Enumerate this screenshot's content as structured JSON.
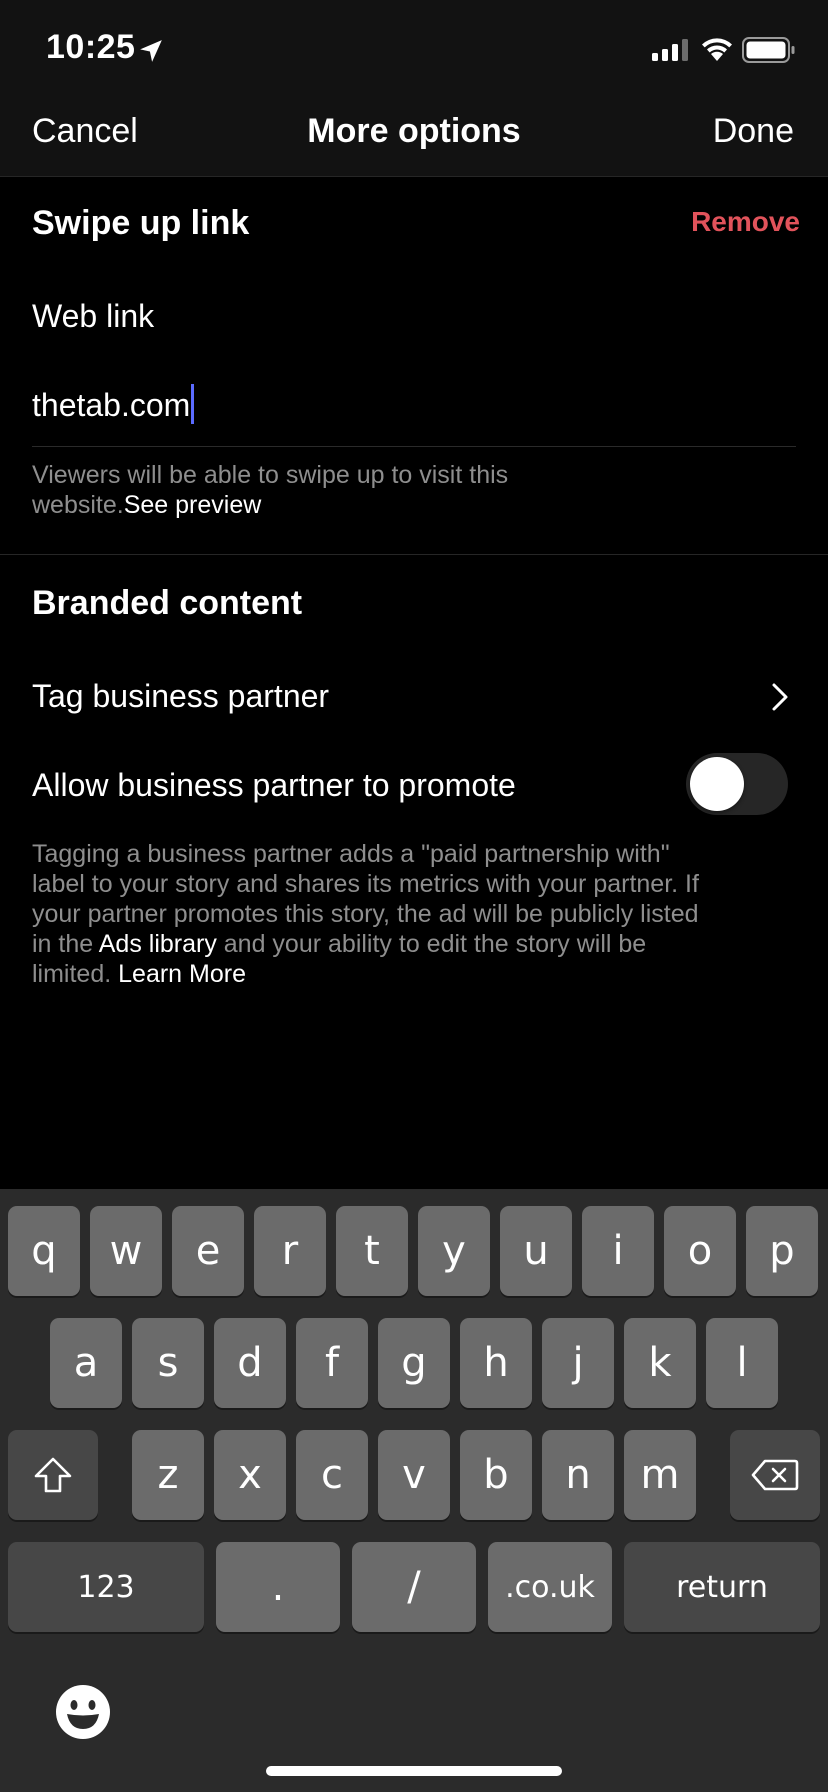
{
  "status_bar": {
    "time": "10:25",
    "location_icon": "location-arrow-icon",
    "signal_icon": "cellular-signal-icon",
    "wifi_icon": "wifi-icon",
    "battery_icon": "battery-icon"
  },
  "nav": {
    "cancel": "Cancel",
    "title": "More options",
    "done": "Done"
  },
  "swipe_up": {
    "title": "Swipe up link",
    "remove": "Remove",
    "field_label": "Web link",
    "field_value": "thetab.com",
    "helper_line1": "Viewers will be able to swipe up to visit this",
    "helper_line2": "website.",
    "helper_link": "See preview"
  },
  "branded": {
    "title": "Branded content",
    "tag_partner": "Tag business partner",
    "allow_promote": "Allow business partner to promote",
    "toggle_on": false,
    "info_line1": "Tagging a business partner adds a \"paid partnership with\"",
    "info_line2": "label to your story and shares its metrics with your partner. If",
    "info_line3": "your partner promotes this story, the ad will be publicly listed",
    "info_line4_pre": "in the ",
    "info_line4_link": "Ads library",
    "info_line4_post": " and your ability to edit the story will be",
    "info_line5_pre": "limited. ",
    "info_line5_link": "Learn More"
  },
  "keyboard": {
    "row1": [
      "q",
      "w",
      "e",
      "r",
      "t",
      "y",
      "u",
      "i",
      "o",
      "p"
    ],
    "row2": [
      "a",
      "s",
      "d",
      "f",
      "g",
      "h",
      "j",
      "k",
      "l"
    ],
    "row3": [
      "z",
      "x",
      "c",
      "v",
      "b",
      "n",
      "m"
    ],
    "numbers": "123",
    "dot": ".",
    "slash": "/",
    "domain": ".co.uk",
    "return": "return",
    "shift_icon": "shift-arrow-icon",
    "delete_icon": "backspace-icon",
    "emoji_icon": "emoji-face-icon"
  },
  "colors": {
    "remove": "#e1535b",
    "caret": "#5b6bff",
    "helper_text": "#8e8e8e",
    "key": "#6b6b6b",
    "key_dark": "#474747",
    "keyboard_bg": "#2b2b2b"
  }
}
